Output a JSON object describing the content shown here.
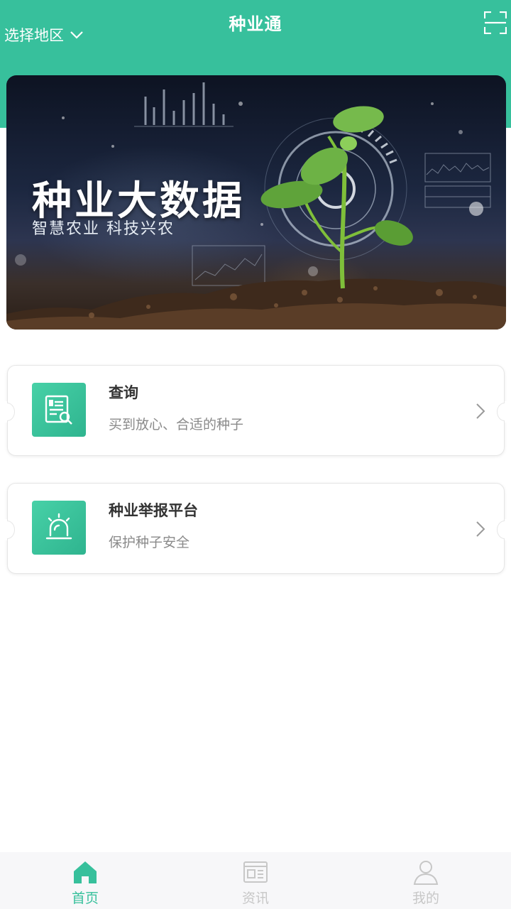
{
  "header": {
    "title": "种业通",
    "region_label": "选择地区"
  },
  "banner": {
    "title": "种业大数据",
    "subtitle": "智慧农业 科技兴农"
  },
  "cards": [
    {
      "title": "查询",
      "subtitle": "买到放心、合适的种子",
      "icon": "seed-search-icon"
    },
    {
      "title": "种业举报平台",
      "subtitle": "保护种子安全",
      "icon": "alarm-icon"
    }
  ],
  "tabbar": {
    "items": [
      {
        "label": "首页",
        "icon": "home-icon",
        "active": true
      },
      {
        "label": "资讯",
        "icon": "news-icon",
        "active": false
      },
      {
        "label": "我的",
        "icon": "user-icon",
        "active": false
      }
    ]
  },
  "colors": {
    "accent": "#37c09c",
    "inactive": "#c7c7c7"
  }
}
